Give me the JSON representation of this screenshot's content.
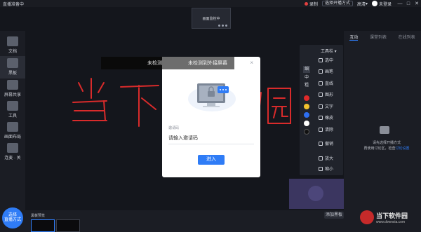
{
  "titlebar": {
    "app_title": "直播准备中",
    "record": "录制",
    "select_mode": "选择开播方式",
    "quality": "高清",
    "user": "未登录",
    "minimize": "—",
    "maximize": "□",
    "close": "✕"
  },
  "camera_preview": {
    "label": "画面监控中"
  },
  "sidebar": {
    "items": [
      {
        "label": "文档",
        "icon": "document-icon"
      },
      {
        "label": "黑板",
        "icon": "blackboard-icon"
      },
      {
        "label": "屏幕共享",
        "icon": "screen-share-icon"
      },
      {
        "label": "工具",
        "icon": "toolbox-icon"
      },
      {
        "label": "画面布局",
        "icon": "layout-icon"
      },
      {
        "label": "连麦 · 关",
        "icon": "mic-link-icon"
      }
    ],
    "live_button": "选择\n直播方式"
  },
  "canvas": {
    "notice": "未检测到外接屏幕",
    "handwriting_text": "当下软件园"
  },
  "dialog": {
    "field_label": "邀请码",
    "field_placeholder": "请输入邀请码",
    "enter_button": "进入",
    "close": "×"
  },
  "toolbar": {
    "header": "工具栏 ▾",
    "thickness_labels": [
      "细",
      "中",
      "粗"
    ],
    "colors": [
      "#e02a2a",
      "#f2c12e",
      "#2e6ff2",
      "#ffffff",
      "#111111"
    ],
    "tools": [
      "选中",
      "画笔",
      "直线",
      "图形",
      "文字",
      "橡皮",
      "清除",
      "撤销",
      "放大",
      "缩小"
    ]
  },
  "bottom": {
    "title": "黑板预览",
    "add_board": "添加黑板"
  },
  "right_panel": {
    "tabs": [
      "互动",
      "课堂列表",
      "在线列表"
    ],
    "hint_line1": "请先选择开播方式",
    "hint_line2": "再使用讨论区，检查",
    "hint_link": "讨论设置"
  },
  "watermark": {
    "name": "当下软件园",
    "url": "www.downxia.com"
  }
}
